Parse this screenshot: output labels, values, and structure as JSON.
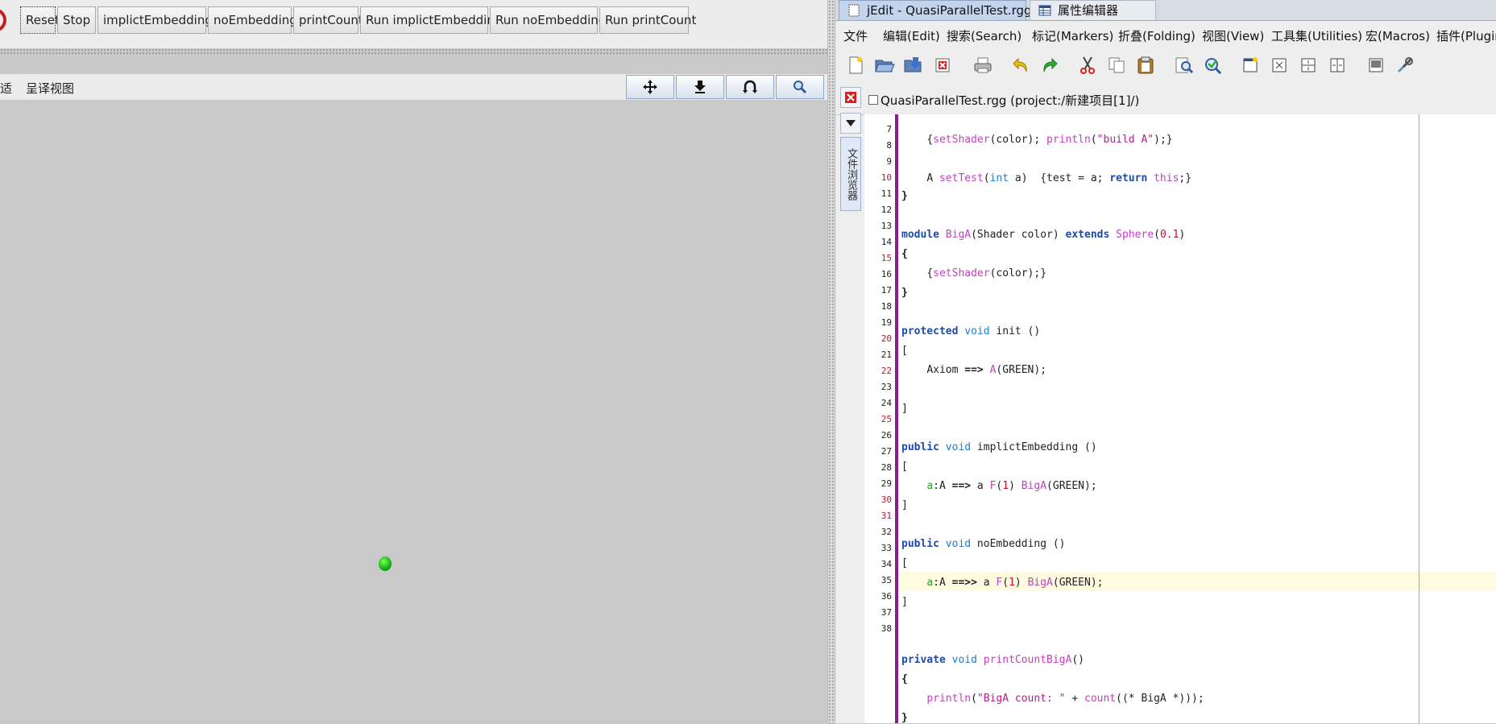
{
  "left": {
    "buttons": [
      {
        "label": "Reset",
        "name": "reset-button"
      },
      {
        "label": "Stop",
        "name": "stop-button"
      },
      {
        "label": "implictEmbedding",
        "name": "implict-embedding-button"
      },
      {
        "label": "noEmbedding",
        "name": "no-embedding-button"
      },
      {
        "label": "printCount",
        "name": "print-count-button"
      },
      {
        "label": "Run implictEmbedding",
        "name": "run-implict-embedding-button"
      },
      {
        "label": "Run noEmbedding",
        "name": "run-no-embedding-button"
      },
      {
        "label": "Run printCount",
        "name": "run-print-count-button"
      }
    ],
    "view": {
      "label_partial": "适",
      "label_render_view": "呈译视图",
      "controls": [
        "move-icon",
        "zoom-down-icon",
        "rotate-icon",
        "search-icon"
      ]
    },
    "colors": {
      "ball": "#18b418"
    }
  },
  "right": {
    "tabs": [
      {
        "label": "jEdit - QuasiParallelTest.rgg"
      },
      {
        "label": "属性编辑器"
      }
    ],
    "menu": [
      "文件",
      "编辑(Edit)",
      "搜索(Search)",
      "标记(Markers)",
      "折叠(Folding)",
      "视图(View)",
      "工具集(Utilities)",
      "宏(Macros)",
      "插件(Plugin"
    ],
    "toolbar_icons": [
      "new-file-icon",
      "open-file-icon",
      "save-icon",
      "close-file-icon",
      "print-icon",
      "undo-icon",
      "redo-icon",
      "cut-icon",
      "copy-icon",
      "paste-icon",
      "find-icon",
      "find-replace-icon",
      "new-view-icon",
      "unsplit-icon",
      "split-horizontal-icon",
      "split-vertical-icon",
      "buffer-options-icon",
      "global-options-icon"
    ],
    "file_title": "QuasiParallelTest.rgg (project:/新建项目[1]/)",
    "sidebar_label": "文件浏览器",
    "line_numbers": [
      "7",
      "8",
      "9",
      "10",
      "11",
      "12",
      "13",
      "14",
      "15",
      "16",
      "17",
      "18",
      "19",
      "20",
      "21",
      "22",
      "23",
      "24",
      "25",
      "26",
      "27",
      "28",
      "29",
      "30",
      "31",
      "32",
      "33",
      "34",
      "35",
      "36",
      "37",
      "38"
    ],
    "red_line_numbers": [
      "10",
      "15",
      "20",
      "22",
      "25",
      "30",
      "31"
    ],
    "code": {
      "l8": {
        "a": "{",
        "b": "setShader",
        "c": "(color); ",
        "d": "println",
        "e": "(",
        "f": "\"build A\"",
        "g": ");}"
      },
      "l10": {
        "a": "A ",
        "b": "setTest",
        "c": "(",
        "d": "int",
        "e": " a)  {test = a; ",
        "f": "return",
        "g": " ",
        "h": "this",
        "i": ";}"
      },
      "l11": "}",
      "l13": {
        "a": "module",
        "b": " ",
        "c": "BigA",
        "d": "(Shader color) ",
        "e": "extends",
        "f": " ",
        "g": "Sphere",
        "h": "(",
        "i": "0.1",
        "j": ")"
      },
      "l14": "{",
      "l15": {
        "a": "{",
        "b": "setShader",
        "c": "(color);}"
      },
      "l16": "}",
      "l18": {
        "a": "protected",
        "b": " ",
        "c": "void",
        "d": " init ()"
      },
      "l19": "[",
      "l20": {
        "a": "Axiom ",
        "b": "==>",
        "c": " ",
        "d": "A",
        "e": "(GREEN);"
      },
      "l22": "]",
      "l24": {
        "a": "public",
        "b": " ",
        "c": "void",
        "d": " implictEmbedding ()"
      },
      "l25": "[",
      "l26": {
        "a": "a",
        "b": ":A ",
        "c": "==>",
        "d": " a ",
        "e": "F",
        "f": "(",
        "g": "1",
        "h": ") ",
        "i": "BigA",
        "j": "(GREEN);"
      },
      "l27": "]",
      "l29": {
        "a": "public",
        "b": " ",
        "c": "void",
        "d": " noEmbedding ()"
      },
      "l30": "[",
      "l31": {
        "a": "a",
        "b": ":A ",
        "c": "==>>",
        "d": " a ",
        "e": "F",
        "f": "(",
        "g": "1",
        "h": ") ",
        "i": "BigA",
        "j": "(GREEN);"
      },
      "l32": "]",
      "l35": {
        "a": "private",
        "b": " ",
        "c": "void",
        "d": " ",
        "e": "printCountBigA",
        "f": "()"
      },
      "l36": "{",
      "l37": {
        "a": "println",
        "b": "(",
        "c": "\"BigA count: \"",
        "d": " + ",
        "e": "count",
        "f": "((* BigA *)));"
      },
      "l38": "}"
    }
  }
}
